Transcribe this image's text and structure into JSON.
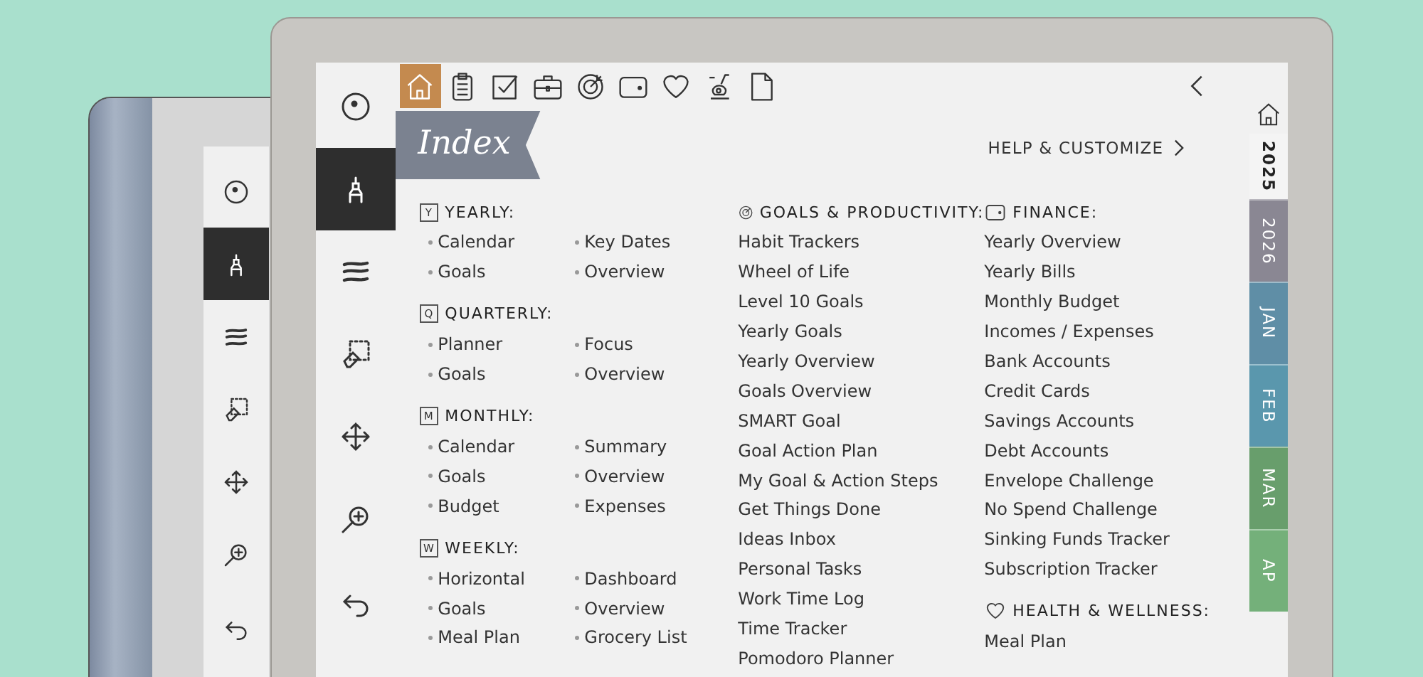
{
  "back_device": {
    "toolbar": [
      {
        "kind": "pointer",
        "selected": false
      },
      {
        "kind": "pen",
        "selected": true
      },
      {
        "kind": "brush",
        "selected": false
      },
      {
        "kind": "eraser",
        "selected": false
      },
      {
        "kind": "move",
        "selected": false
      },
      {
        "kind": "zoom",
        "selected": false
      },
      {
        "kind": "undo",
        "selected": false
      }
    ]
  },
  "device": {
    "toolbar": [
      {
        "kind": "pointer",
        "selected": false
      },
      {
        "kind": "pen",
        "selected": true
      },
      {
        "kind": "brush",
        "selected": false
      },
      {
        "kind": "eraser",
        "selected": false
      },
      {
        "kind": "move",
        "selected": false
      },
      {
        "kind": "zoom",
        "selected": false
      },
      {
        "kind": "undo",
        "selected": false
      }
    ],
    "top_nav": [
      {
        "kind": "home",
        "selected": true
      },
      {
        "kind": "clipboard",
        "selected": false
      },
      {
        "kind": "checkbox",
        "selected": false
      },
      {
        "kind": "briefcase",
        "selected": false
      },
      {
        "kind": "target",
        "selected": false
      },
      {
        "kind": "wallet",
        "selected": false
      },
      {
        "kind": "heart",
        "selected": false
      },
      {
        "kind": "bike",
        "selected": false
      },
      {
        "kind": "page",
        "selected": false
      }
    ],
    "title": "Index",
    "help_link": "HELP & CUSTOMIZE",
    "columns": [
      [
        {
          "title": "YEARLY:",
          "badge": "Y",
          "kind": "calendar",
          "bullets": true,
          "items": [
            "Calendar",
            "Key Dates",
            "Goals",
            "Overview"
          ]
        },
        {
          "title": "QUARTERLY:",
          "badge": "Q",
          "kind": "calendar",
          "bullets": true,
          "items": [
            "Planner",
            "Focus",
            "Goals",
            "Overview"
          ]
        },
        {
          "title": "MONTHLY:",
          "badge": "M",
          "kind": "calendar",
          "bullets": true,
          "items": [
            "Calendar",
            "Summary",
            "Goals",
            "Overview",
            "Budget",
            "Expenses"
          ]
        },
        {
          "title": "WEEKLY:",
          "badge": "W",
          "kind": "calendar",
          "bullets": true,
          "items": [
            "Horizontal",
            "Dashboard",
            "Goals",
            "Overview",
            "Meal Plan",
            "Grocery List"
          ]
        }
      ],
      [
        {
          "title": "GOALS & PRODUCTIVITY:",
          "kind": "target",
          "bullets": false,
          "items": [
            "Habit Trackers",
            "Wheel of Life",
            "Level 10 Goals",
            "Yearly Goals",
            "Yearly Overview",
            "Goals Overview",
            "SMART Goal",
            "Goal Action Plan",
            "My Goal & Action Steps",
            "Get Things Done",
            "Ideas Inbox",
            "Personal Tasks",
            "Work Time Log",
            "Time Tracker",
            "Pomodoro Planner"
          ]
        }
      ],
      [
        {
          "title": "FINANCE:",
          "kind": "wallet",
          "bullets": false,
          "items": [
            "Yearly Overview",
            "Yearly Bills",
            "Monthly Budget",
            "Incomes / Expenses",
            "Bank Accounts",
            "Credit Cards",
            "Savings Accounts",
            "Debt Accounts",
            "Envelope Challenge",
            "No Spend Challenge",
            "Sinking Funds Tracker",
            "Subscription Tracker"
          ]
        },
        {
          "title": "HEALTH & WELLNESS:",
          "kind": "heart",
          "bullets": false,
          "items": [
            "Meal Plan"
          ]
        }
      ]
    ],
    "side_tabs": [
      {
        "kind": "home"
      },
      {
        "kind": "label",
        "label": "2025",
        "selected": true
      },
      {
        "kind": "label",
        "label": "2026",
        "selected": false,
        "color": "#8a8793"
      },
      {
        "kind": "label",
        "label": "JAN",
        "selected": false,
        "color": "#5f8ea6"
      },
      {
        "kind": "label",
        "label": "FEB",
        "selected": false,
        "color": "#5a97ad"
      },
      {
        "kind": "label",
        "label": "MAR",
        "selected": false,
        "color": "#689e6c"
      },
      {
        "kind": "label",
        "label": "AP",
        "selected": false,
        "color": "#74b07a"
      }
    ]
  }
}
